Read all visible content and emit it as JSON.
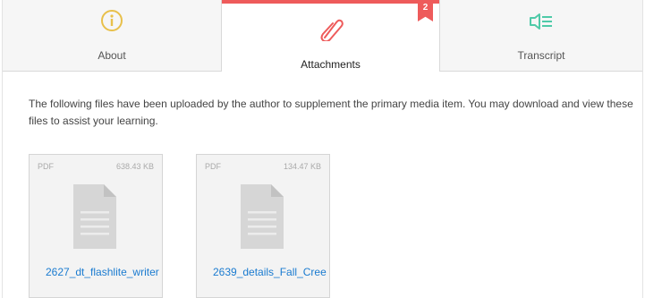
{
  "tabs": [
    {
      "label": "About",
      "icon": "info-icon",
      "color": "#e8c04a"
    },
    {
      "label": "Attachments",
      "icon": "paperclip-icon",
      "color": "#ee5b5b",
      "badge": "2",
      "active": true
    },
    {
      "label": "Transcript",
      "icon": "speaker-lines-icon",
      "color": "#4fcaa8"
    }
  ],
  "description": "The following files have been uploaded by the author to supplement the primary media item. You may download and view these files to assist your learning.",
  "files": [
    {
      "type": "PDF",
      "size": "638.43 KB",
      "name": "2627_dt_flashlite_writer",
      "icon": "document-icon"
    },
    {
      "type": "PDF",
      "size": "134.47 KB",
      "name": "2639_details_Fall_Cree",
      "icon": "document-icon"
    }
  ],
  "colors": {
    "accent": "#ee5b5b",
    "link": "#1a7bd0"
  }
}
